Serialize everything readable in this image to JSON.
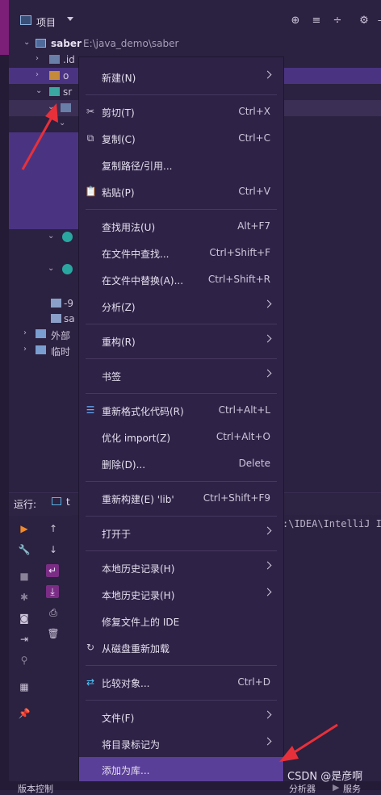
{
  "project_header": {
    "title": "项目"
  },
  "tree": {
    "root_name": "saber",
    "root_path": "E:\\java_demo\\saber",
    "rows": [
      {
        "label": ".id"
      },
      {
        "label": "o"
      },
      {
        "label": "sr"
      },
      {
        "label": ""
      },
      {
        "label": ""
      },
      {
        "label": ""
      },
      {
        "label": ""
      },
      {
        "label": "-9"
      },
      {
        "label": "sa"
      },
      {
        "label": "外部"
      },
      {
        "label": "临时"
      }
    ]
  },
  "context_menu": {
    "items": [
      {
        "label": "新建(N)",
        "shortcut": "",
        "submenu": true
      },
      {
        "label": "剪切(T)",
        "shortcut": "Ctrl+X"
      },
      {
        "label": "复制(C)",
        "shortcut": "Ctrl+C"
      },
      {
        "label": "复制路径/引用...",
        "shortcut": ""
      },
      {
        "label": "粘贴(P)",
        "shortcut": "Ctrl+V"
      },
      {
        "label": "查找用法(U)",
        "shortcut": "Alt+F7"
      },
      {
        "label": "在文件中查找...",
        "shortcut": "Ctrl+Shift+F"
      },
      {
        "label": "在文件中替换(A)...",
        "shortcut": "Ctrl+Shift+R"
      },
      {
        "label": "分析(Z)",
        "shortcut": "",
        "submenu": true
      },
      {
        "label": "重构(R)",
        "shortcut": "",
        "submenu": true
      },
      {
        "label": "书签",
        "shortcut": "",
        "submenu": true
      },
      {
        "label": "重新格式化代码(R)",
        "shortcut": "Ctrl+Alt+L"
      },
      {
        "label": "优化 import(Z)",
        "shortcut": "Ctrl+Alt+O"
      },
      {
        "label": "删除(D)...",
        "shortcut": "Delete"
      },
      {
        "label": "重新构建(E) 'lib'",
        "shortcut": "Ctrl+Shift+F9"
      },
      {
        "label": "打开于",
        "shortcut": "",
        "submenu": true
      },
      {
        "label": "本地历史记录(H)",
        "shortcut": "",
        "submenu": true
      },
      {
        "label": "本地历史记录(H)",
        "shortcut": "",
        "submenu": true
      },
      {
        "label": "修复文件上的 IDE",
        "shortcut": ""
      },
      {
        "label": "从磁盘重新加载",
        "shortcut": ""
      },
      {
        "label": "比较对象...",
        "shortcut": "Ctrl+D"
      },
      {
        "label": "文件(F)",
        "shortcut": "",
        "submenu": true
      },
      {
        "label": "将目录标记为",
        "shortcut": "",
        "submenu": true
      },
      {
        "label": "添加为库...",
        "shortcut": ""
      }
    ]
  },
  "run_panel": {
    "label": "运行:",
    "tab_label": "t",
    "console_text": ":\\IDEA\\IntelliJ ID"
  },
  "bottom_bar": {
    "left_text": "版本控制",
    "analyzer_text": "分析器",
    "services_text": "服务"
  },
  "watermark": "CSDN @是彦啊",
  "colors": {
    "menu_bg": "#2e2246",
    "menu_highlight": "#5a3f99",
    "selection": "#4a3481",
    "arrow_red": "#e8303a"
  }
}
